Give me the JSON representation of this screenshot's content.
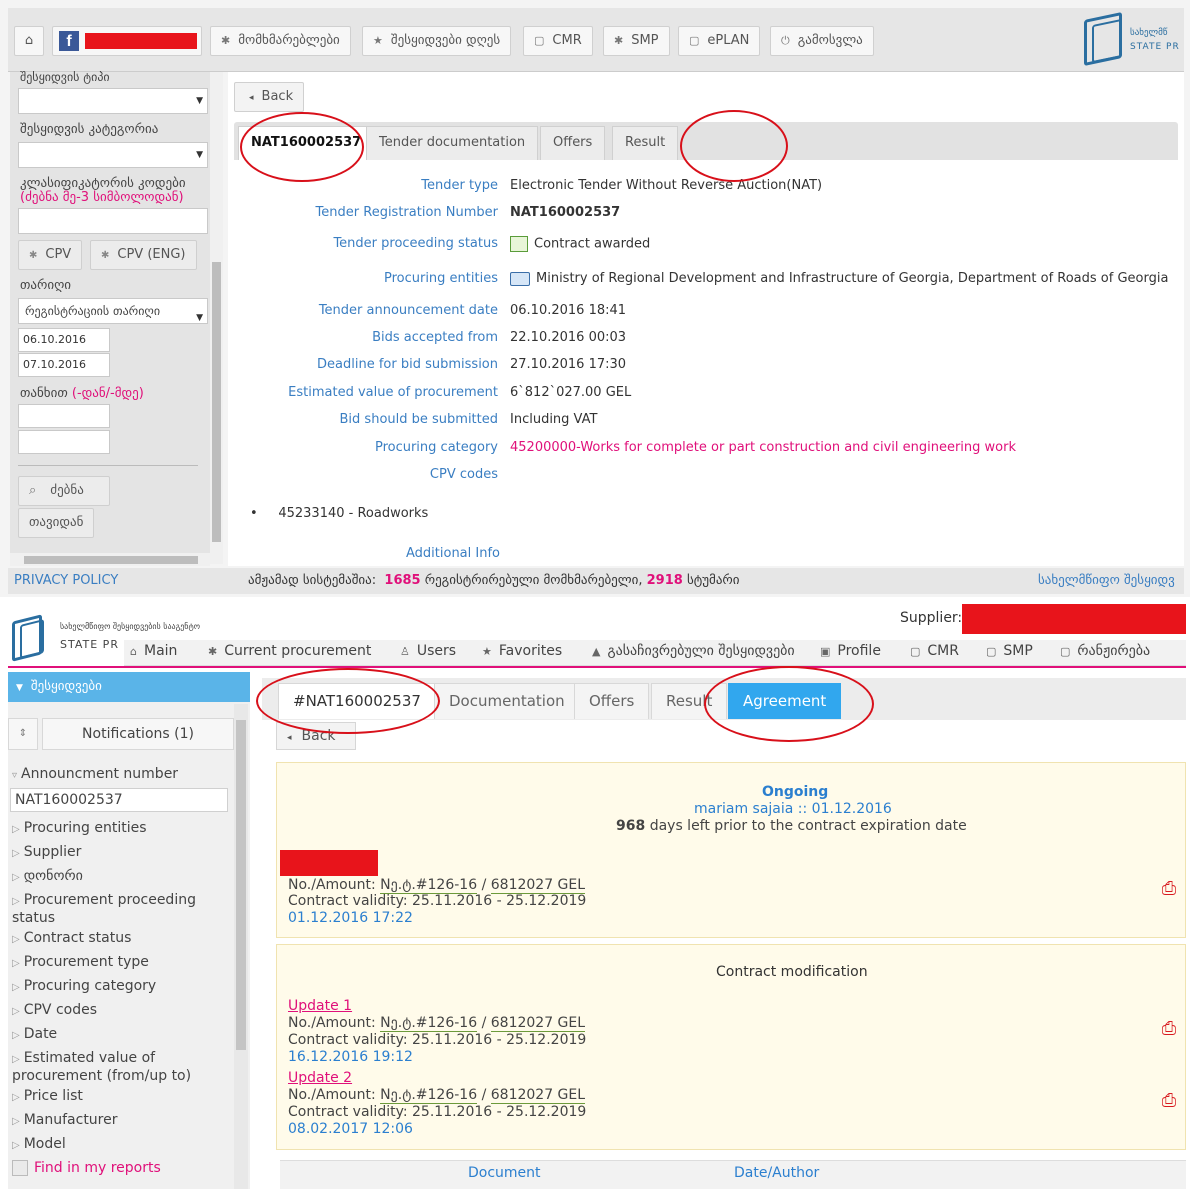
{
  "top": {
    "nav": {
      "home_icon": "home-icon",
      "users": "მომხმარებლები",
      "today_tenders": "შესყიდვები დღეს",
      "cmr": "CMR",
      "smp": "SMP",
      "eplan": "ePLAN",
      "logout": "გამოსვლა"
    },
    "logo_text": "სახელმწ\nSTATE PR",
    "logo_line1": "სახელმწ",
    "logo_line2": "STATE PR",
    "sidebar": {
      "label_type": "შესყიდვის ტიპი",
      "label_category": "შესყიდვის კატეგორია",
      "label_classifier": "კლასიფიკატორის კოდები",
      "classifier_hint": "(ძებნა მე-3 სიმბოლოდან)",
      "cpv_button": "CPV",
      "cpv_eng_button": "CPV (ENG)",
      "label_date": "თარიღი",
      "date_type_value": "რეგისტრაციის თარიღი",
      "date_from": "06.10.2016",
      "date_to": "07.10.2016",
      "label_amount": "თანხით",
      "amount_hint": "(-დან/-მდე)",
      "search_button": "ძებნა",
      "reset_button": "თავიდან"
    },
    "back_label": "Back",
    "tabs": [
      "NAT160002537",
      "Tender documentation",
      "Offers",
      "Result"
    ],
    "details": [
      {
        "label": "Tender type",
        "value": "Electronic Tender Without Reverse Auction(NAT)"
      },
      {
        "label": "Tender Registration Number",
        "value": "NAT160002537"
      },
      {
        "label": "Tender proceeding status",
        "value": "Contract awarded"
      },
      {
        "label": "Procuring entities",
        "value": "Ministry of Regional Development and Infrastructure of Georgia, Department of Roads of Georgia"
      },
      {
        "label": "Tender announcement date",
        "value": "06.10.2016 18:41"
      },
      {
        "label": "Bids accepted from",
        "value": "22.10.2016 00:03"
      },
      {
        "label": "Deadline for bid submission",
        "value": "27.10.2016 17:30"
      },
      {
        "label": "Estimated value of procurement",
        "value": "6`812`027.00 GEL"
      },
      {
        "label": "Bid should be submitted",
        "value": "Including VAT"
      },
      {
        "label": "Procuring category",
        "value": "45200000-Works for complete or part construction and civil engineering work"
      },
      {
        "label": "CPV codes",
        "value": ""
      }
    ],
    "cpv_item": "45233140 - Roadworks",
    "additional_info": "Additional Info",
    "footer": {
      "privacy": "PRIVACY POLICY",
      "stats_prefix": "ამჟამად სისტემაშია:",
      "registered_count": "1685",
      "registered_label": "რეგისტრირებული მომხმარებელი,",
      "guest_count": "2918",
      "guest_label": "სტუმარი",
      "right_link": "სახელმწიფო შესყიდვ"
    }
  },
  "bottom": {
    "logo_line1": "სახელმწიფო შესყიდვების სააგენტო",
    "logo_line2": "STATE PR",
    "supplier_label": "Supplier:",
    "nav": [
      "Main",
      "Current procurement",
      "Users",
      "Favorites",
      "გასაჩივრებული შესყიდვები",
      "Profile",
      "CMR",
      "SMP",
      "რანჟირება"
    ],
    "sidebar": {
      "header": "შესყიდვები",
      "notifications": "Notifications (1)",
      "announcement_label": "Announcment number",
      "announcement_value": "NAT160002537",
      "items": [
        "Procuring entities",
        "Supplier",
        "დონორი",
        "Procurement proceeding status",
        "Contract status",
        "Procurement type",
        "Procuring category",
        "CPV codes",
        "Date",
        "Estimated value of procurement (from/up to)",
        "Price list",
        "Manufacturer",
        "Model"
      ],
      "find_in_reports": "Find in my reports"
    },
    "tabs": [
      "#NAT160002537",
      "Documentation",
      "Offers",
      "Result",
      "Agreement"
    ],
    "back_label": "Back",
    "agreement": {
      "status": "Ongoing",
      "author_date": "mariam sajaia :: 01.12.2016",
      "days_left_count": "968",
      "days_left_text": "days left prior to the contract expiration date",
      "contract": {
        "number_amount_prefix": "No./Amount:",
        "number": "Nე.ტ.#126-16",
        "amount": "6812027 GEL",
        "validity": "Contract validity: 25.11.2016 - 25.12.2019",
        "timestamp": "01.12.2016 17:22"
      },
      "modification_title": "Contract modification",
      "updates": [
        {
          "title": "Update 1",
          "number": "Nე.ტ.#126-16",
          "amount": "6812027 GEL",
          "validity": "Contract validity: 25.11.2016 - 25.12.2019",
          "timestamp": "16.12.2016 19:12"
        },
        {
          "title": "Update 2",
          "number": "Nე.ტ.#126-16",
          "amount": "6812027 GEL",
          "validity": "Contract validity: 25.11.2016 - 25.12.2019",
          "timestamp": "08.02.2017 12:06"
        }
      ],
      "table_headers": [
        "Document",
        "Date/Author"
      ]
    }
  },
  "colors": {
    "link_blue": "#3a7ec2",
    "pink": "#e0107a",
    "tab_blue": "#31a7ee",
    "annotation_red": "#d8101a",
    "redaction": "#e8141b"
  }
}
